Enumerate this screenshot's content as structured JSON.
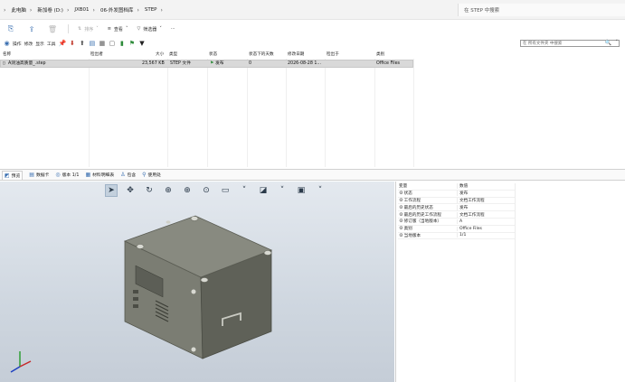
{
  "breadcrumb": [
    "此电脑",
    "新加卷 (D:)",
    "JXB01",
    "06-外发图档库",
    "STEP"
  ],
  "search_placeholder": "在 STEP 中搜索",
  "commands": {
    "sort": "排序",
    "view": "查看",
    "filter": "筛选器",
    "more": "···"
  },
  "pdm_menus": [
    "操作",
    "修改",
    "显示",
    "工具"
  ],
  "pdm_search_placeholder": "在 所有文件夹 中搜索",
  "columns": [
    "名称",
    "检出者",
    "大小",
    "类型",
    "状态",
    "状态下的天数",
    "修改日期",
    "检出于",
    "类别"
  ],
  "files": [
    {
      "name": "A测油高质量_.step",
      "checked_out_by": "",
      "size": "23,567 KB",
      "type": "STEP 文件",
      "state": "发布",
      "days": "0",
      "modified": "2026-08-28 1...",
      "checked_out_on": "",
      "category": "Office Files"
    }
  ],
  "preview_tabs": [
    {
      "label": "预览",
      "icon": "preview-icon"
    },
    {
      "label": "数据卡",
      "icon": "datacard-icon"
    },
    {
      "label": "版本 1/1",
      "icon": "version-icon"
    },
    {
      "label": "材料明细表",
      "icon": "bom-icon"
    },
    {
      "label": "包含",
      "icon": "contains-icon"
    },
    {
      "label": "使用处",
      "icon": "where-used-icon"
    }
  ],
  "props": {
    "header": {
      "key": "变量",
      "value": "数值"
    },
    "rows": [
      {
        "key": "状态",
        "value": "发布"
      },
      {
        "key": "工作流程",
        "value": "文档工作流程"
      },
      {
        "key": "最后的历史状态",
        "value": "发布"
      },
      {
        "key": "最后的历史工作流程",
        "value": "文档工作流程"
      },
      {
        "key": "修订版（当地版本）",
        "value": "A"
      },
      {
        "key": "类别",
        "value": "Office Files"
      },
      {
        "key": "当地版本",
        "value": "1/1"
      }
    ]
  },
  "colors": {
    "selected_row": "#d9d9d9",
    "viewport_top": "#e4e9ef",
    "viewport_bottom": "#c5cdd7",
    "model_body": "#76786f",
    "accent": "#3a6fb0"
  }
}
